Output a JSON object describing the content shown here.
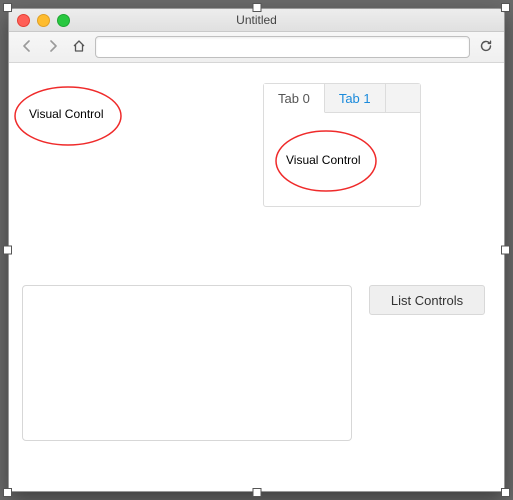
{
  "window": {
    "title": "Untitled"
  },
  "toolbar": {
    "url_value": ""
  },
  "visual_control_1": {
    "label": "Visual Control"
  },
  "tabpanel": {
    "tabs": [
      {
        "label": "Tab 0"
      },
      {
        "label": "Tab 1"
      }
    ],
    "visual_control_2": {
      "label": "Visual Control"
    }
  },
  "list_button": {
    "label": "List Controls"
  },
  "colors": {
    "ellipse_stroke": "#ef2a2a",
    "tab_link": "#1a8adb"
  }
}
